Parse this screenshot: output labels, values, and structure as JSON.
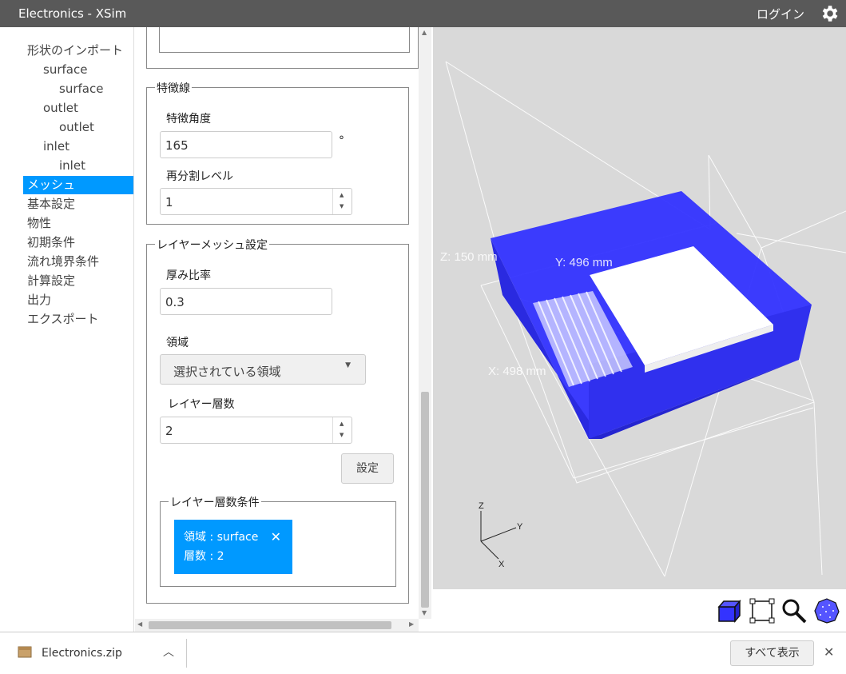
{
  "window": {
    "title": "Electronics - XSim",
    "login": "ログイン"
  },
  "nav": {
    "items": [
      {
        "label": "形状のインポート",
        "level": 0
      },
      {
        "label": "surface",
        "level": 1
      },
      {
        "label": "surface",
        "level": 2
      },
      {
        "label": "outlet",
        "level": 1
      },
      {
        "label": "outlet",
        "level": 2
      },
      {
        "label": "inlet",
        "level": 1
      },
      {
        "label": "inlet",
        "level": 2
      },
      {
        "label": "メッシュ",
        "level": 0,
        "active": true
      },
      {
        "label": "基本設定",
        "level": 0
      },
      {
        "label": "物性",
        "level": 0
      },
      {
        "label": "初期条件",
        "level": 0
      },
      {
        "label": "流れ境界条件",
        "level": 0
      },
      {
        "label": "計算設定",
        "level": 0
      },
      {
        "label": "出力",
        "level": 0
      },
      {
        "label": "エクスポート",
        "level": 0
      }
    ]
  },
  "feature_lines": {
    "legend": "特徴線",
    "angle_label": "特徴角度",
    "angle_value": "165",
    "angle_unit": "°",
    "refine_label": "再分割レベル",
    "refine_value": "1"
  },
  "layer_mesh": {
    "legend": "レイヤーメッシュ設定",
    "thickness_label": "厚み比率",
    "thickness_value": "0.3",
    "region_label": "領域",
    "region_select": "選択されている領域",
    "layers_label": "レイヤー層数",
    "layers_value": "2",
    "set_button": "設定",
    "conditions": {
      "legend": "レイヤー層数条件",
      "chip_region": "領域 : surface",
      "chip_layers": "層数 : 2"
    }
  },
  "viewport": {
    "dim_z": "Z: 150 mm",
    "dim_y": "Y: 496 mm",
    "dim_x": "X: 498 mm",
    "axis_z": "Z",
    "axis_y": "Y",
    "axis_x": "X",
    "colors": {
      "body": "#3333ff",
      "background": "#d9d9d9"
    },
    "tools": [
      "cube-view-icon",
      "fit-frame-icon",
      "zoom-icon",
      "sphere-view-icon"
    ]
  },
  "download": {
    "filename": "Electronics.zip",
    "show_all": "すべて表示"
  }
}
